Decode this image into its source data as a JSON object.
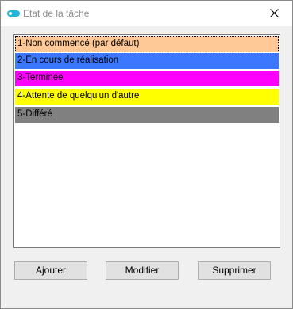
{
  "window": {
    "title": "Etat de la tâche"
  },
  "list": {
    "items": [
      {
        "label": "1-Non commencé (par défaut)",
        "color": "#ffc896"
      },
      {
        "label": "2-En cours de réalisation",
        "color": "#3c78ff"
      },
      {
        "label": "3-Terminée",
        "color": "#ff00ff"
      },
      {
        "label": "4-Attente de quelqu'un d'autre",
        "color": "#ffff00"
      },
      {
        "label": "5-Différé",
        "color": "#808080"
      }
    ],
    "selected_index": 0
  },
  "buttons": {
    "add": "Ajouter",
    "edit": "Modifier",
    "delete": "Supprimer"
  },
  "icons": {
    "app": "toggle-icon",
    "close": "close-icon"
  }
}
